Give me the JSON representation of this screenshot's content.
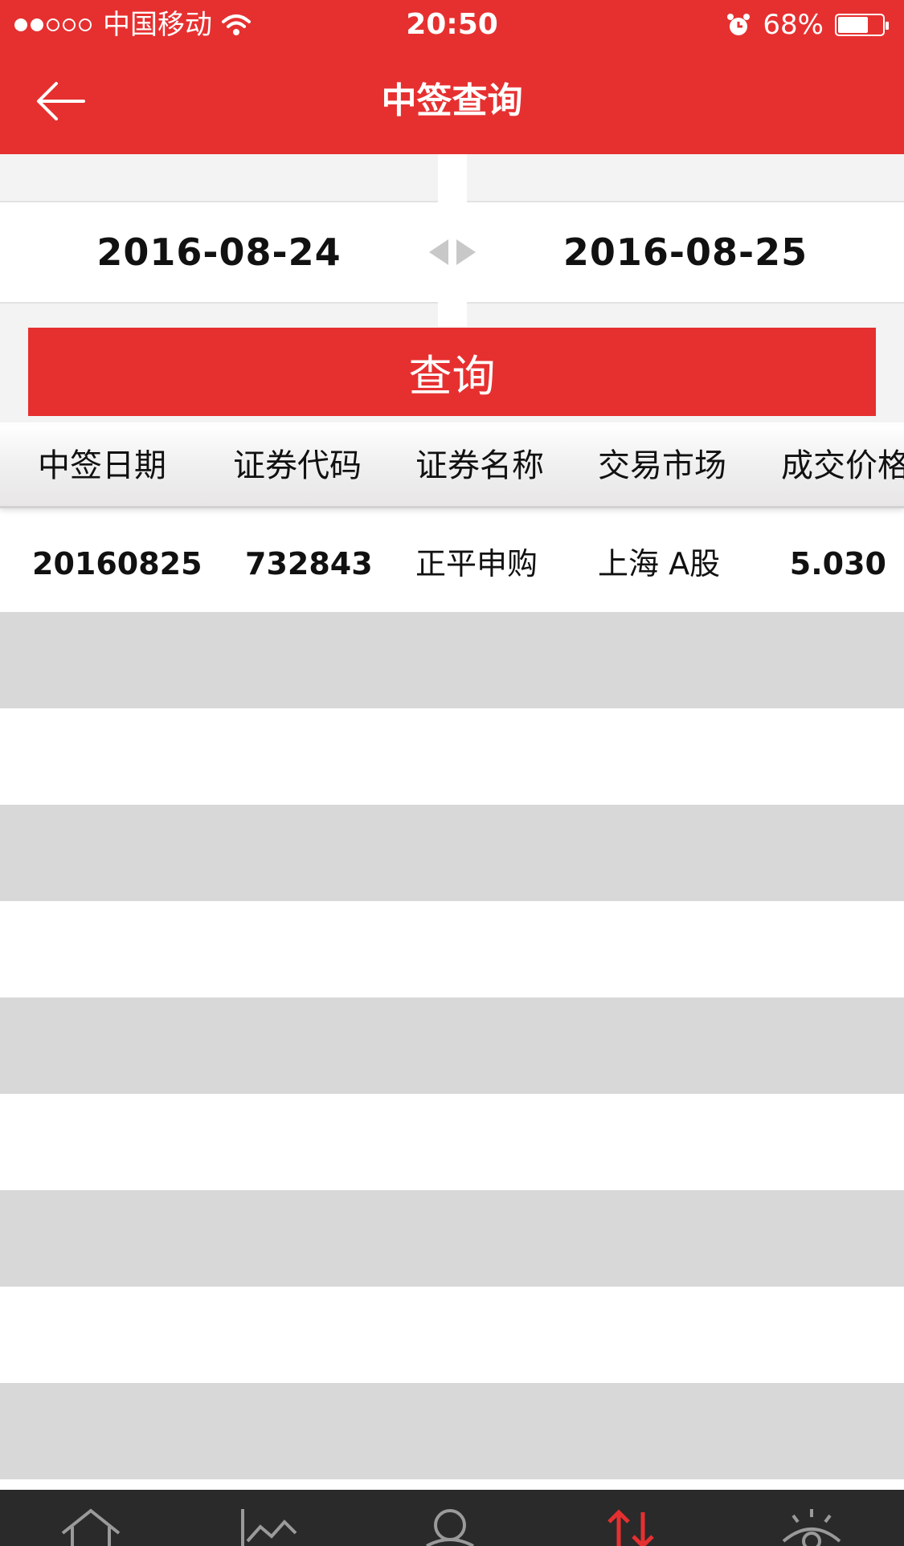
{
  "status_bar": {
    "carrier": "中国移动",
    "time": "20:50",
    "battery": "68%",
    "battery_level": 0.68
  },
  "nav": {
    "title": "中签查询"
  },
  "date_range": {
    "start": "2016-08-24",
    "end": "2016-08-25"
  },
  "query_button": "查询",
  "table": {
    "headers": [
      "中签日期",
      "证券代码",
      "证券名称",
      "交易市场",
      "成交价格"
    ],
    "rows": [
      [
        "20160825",
        "732843",
        "正平申购",
        "上海 A股",
        "5.030"
      ]
    ]
  },
  "tabbar": {
    "icons": [
      "home-icon",
      "chart-icon",
      "user-icon",
      "trade-icon",
      "eye-icon"
    ],
    "active_index": 3
  },
  "colors": {
    "brand_red": "#e63030",
    "stripe_gray": "#d8d8d8",
    "tabbar_dark": "#2a2a2a"
  }
}
